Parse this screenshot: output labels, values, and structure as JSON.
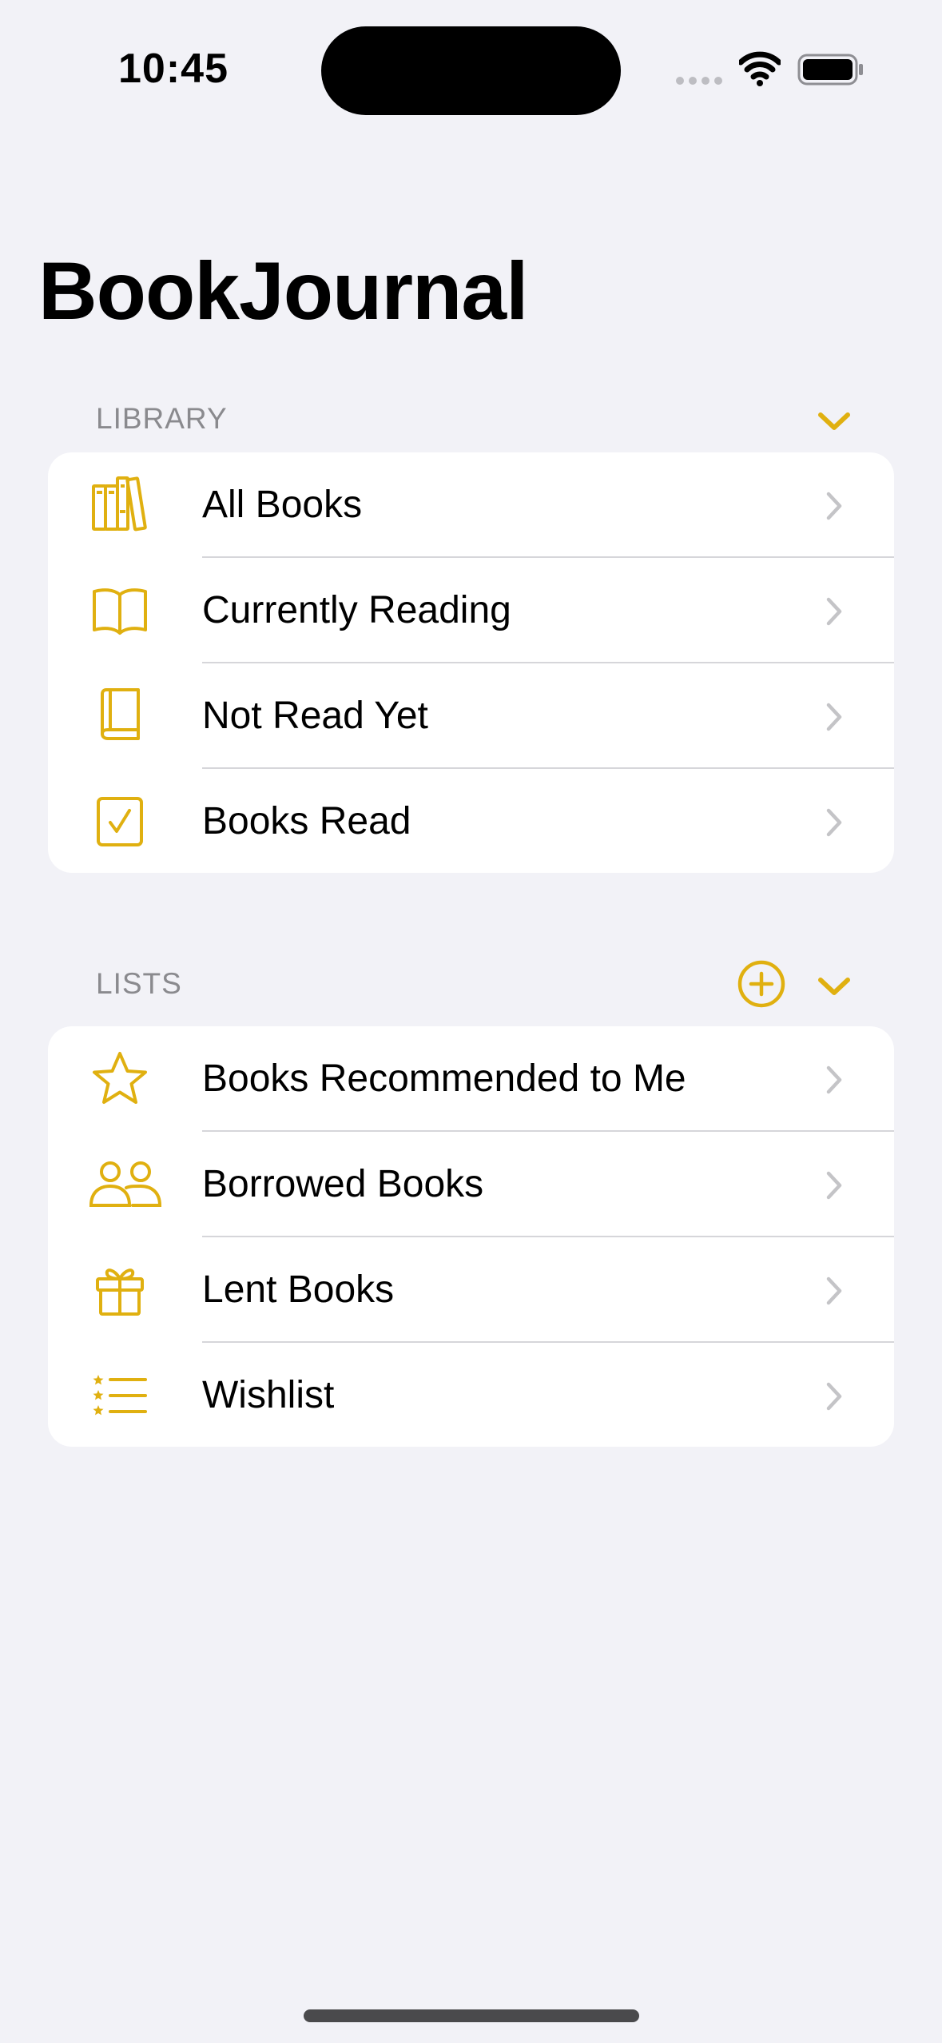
{
  "status_bar": {
    "time": "10:45"
  },
  "app": {
    "title": "BookJournal"
  },
  "library": {
    "header": "LIBRARY",
    "items": [
      {
        "label": "All Books",
        "icon": "books-shelf-icon"
      },
      {
        "label": "Currently Reading",
        "icon": "open-book-icon"
      },
      {
        "label": "Not Read Yet",
        "icon": "closed-book-icon"
      },
      {
        "label": "Books Read",
        "icon": "checkmark-square-icon"
      }
    ]
  },
  "lists": {
    "header": "LISTS",
    "items": [
      {
        "label": "Books Recommended to Me",
        "icon": "star-icon"
      },
      {
        "label": "Borrowed Books",
        "icon": "two-people-icon"
      },
      {
        "label": "Lent Books",
        "icon": "gift-icon"
      },
      {
        "label": "Wishlist",
        "icon": "star-list-icon"
      }
    ]
  },
  "colors": {
    "accent": "#E0B010",
    "background": "#F2F2F7",
    "card": "#FFFFFF",
    "secondary_text": "#8A8A8E",
    "chevron": "#C4C4C7",
    "divider": "#D6D6DA"
  }
}
